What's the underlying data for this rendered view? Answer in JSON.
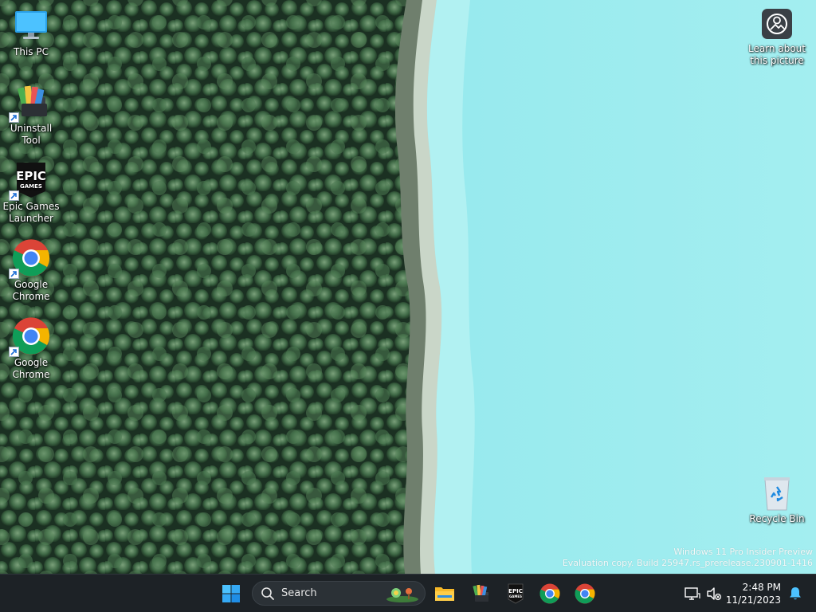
{
  "desktop": {
    "icons": [
      {
        "label": "This PC",
        "icon": "computer-monitor-icon"
      },
      {
        "label": "Uninstall Tool",
        "icon": "uninstall-tool-icon"
      },
      {
        "label": "Epic Games Launcher",
        "icon": "epic-games-icon"
      },
      {
        "label": "Google Chrome",
        "icon": "chrome-icon"
      },
      {
        "label": "Google Chrome",
        "icon": "chrome-icon"
      }
    ],
    "spotlight": {
      "label": "Learn about this picture",
      "icon": "spotlight-camera-icon"
    },
    "recycle_bin": {
      "label": "Recycle Bin",
      "icon": "recycle-bin-icon"
    },
    "watermark": {
      "line1": "Windows 11 Pro Insider Preview",
      "line2": "Evaluation copy. Build 25947.rs_prerelease.230901-1416"
    }
  },
  "taskbar": {
    "search": {
      "placeholder": "Search"
    },
    "pinned": [
      "start-windows-icon",
      "file-explorer-icon",
      "uninstall-tool-icon",
      "epic-games-icon",
      "chrome-icon",
      "chrome-icon"
    ],
    "tray": {
      "time": "2:48 PM",
      "date": "11/21/2023"
    }
  },
  "colors": {
    "taskbar_bg": "#1d2226",
    "lake": "#8fe6ec",
    "forest": "#2c4a32",
    "accent": "#0a84ff"
  }
}
